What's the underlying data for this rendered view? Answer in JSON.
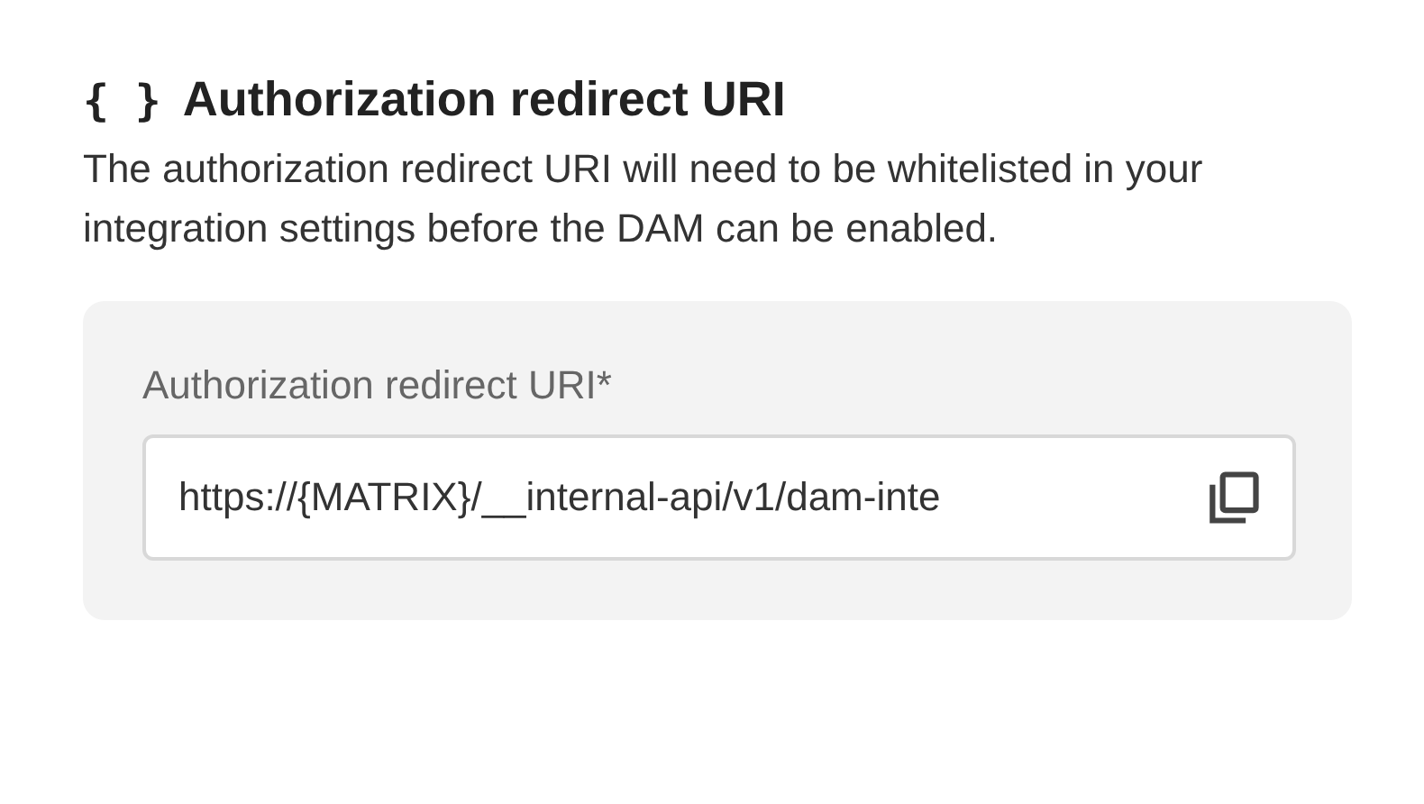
{
  "section": {
    "icon": "{ }",
    "title": "Authorization redirect URI",
    "description": "The authorization redirect URI will need to be whitelisted in your integration settings before the DAM can be enabled."
  },
  "field": {
    "label": "Authorization redirect URI*",
    "value": "https://{MATRIX}/__internal-api/v1/dam-inte"
  }
}
